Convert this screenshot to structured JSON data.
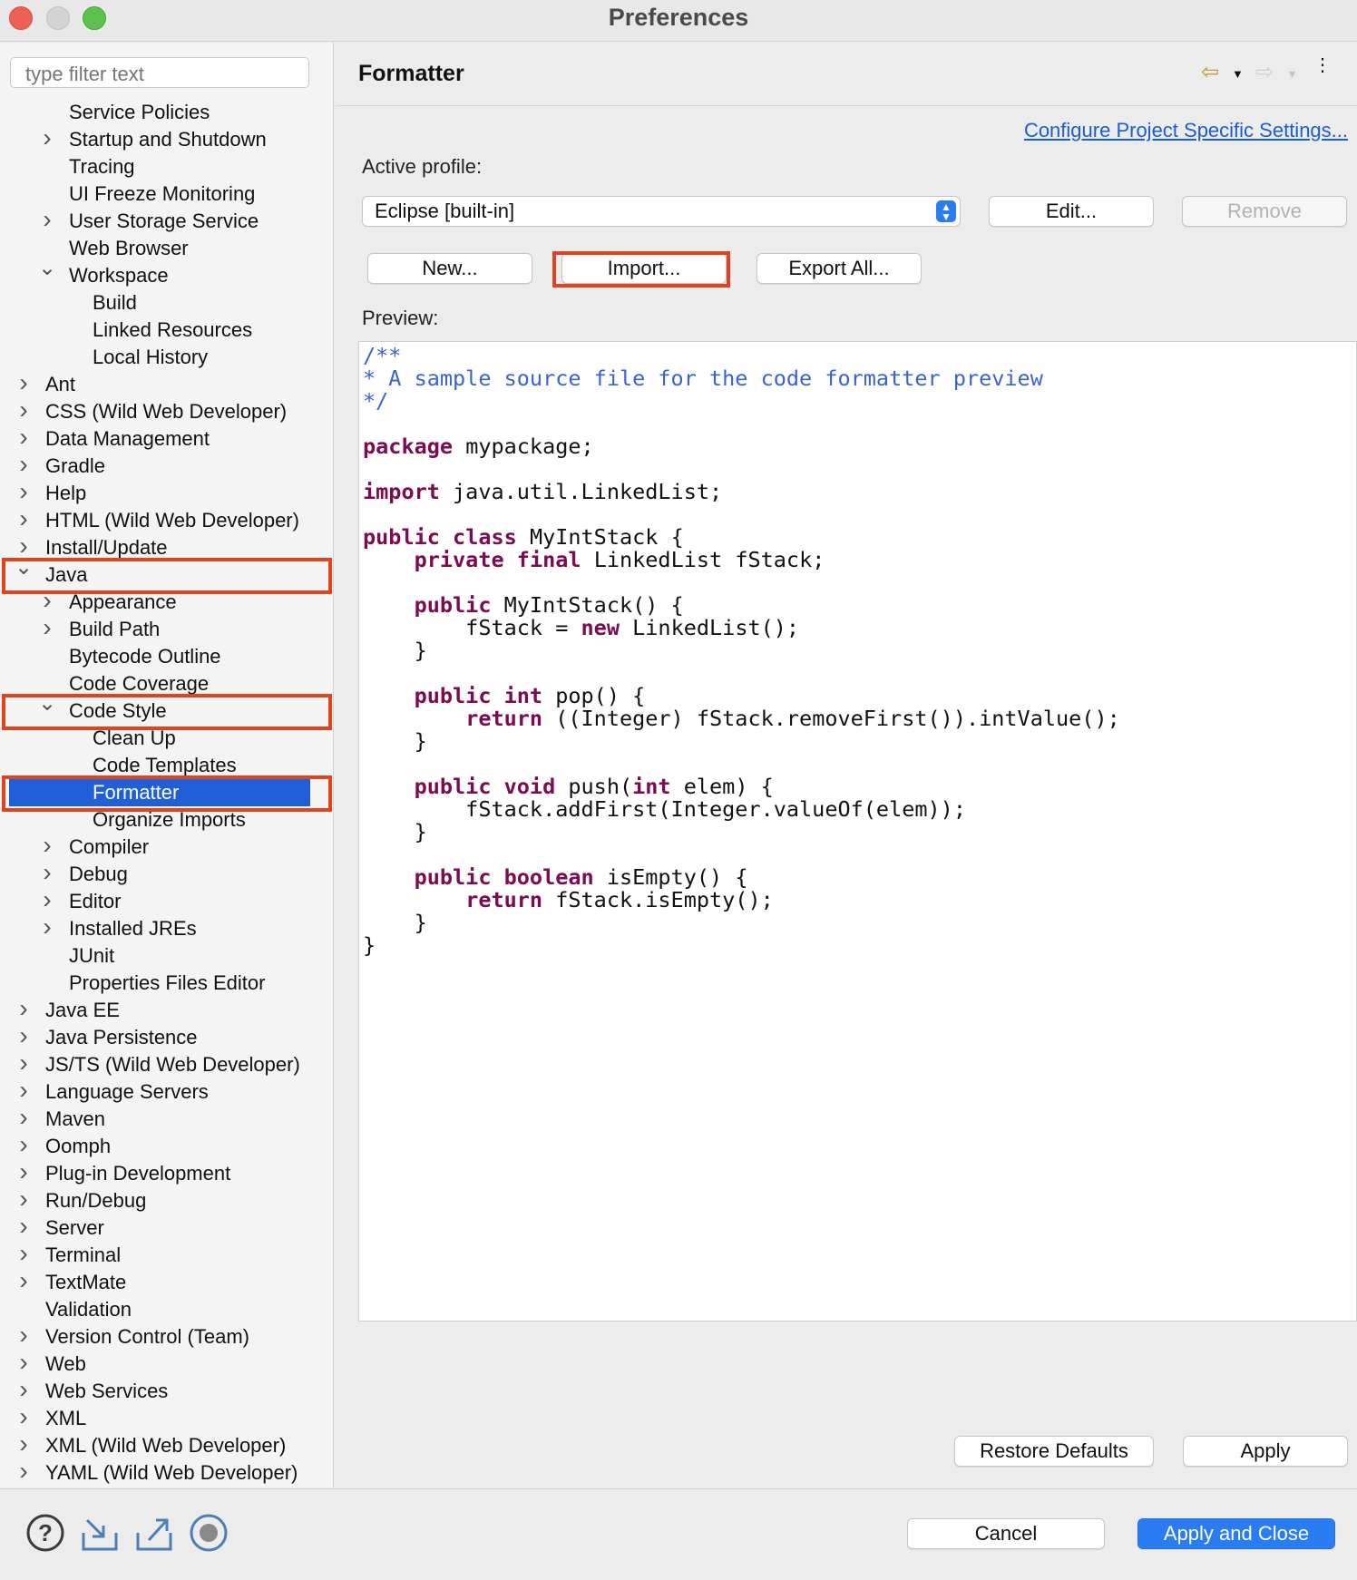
{
  "window": {
    "title": "Preferences"
  },
  "sidebar": {
    "filter_placeholder": "type filter text",
    "items": [
      {
        "label": "Service Policies",
        "level": 1,
        "expander": "none"
      },
      {
        "label": "Startup and Shutdown",
        "level": 1,
        "expander": "collapsed"
      },
      {
        "label": "Tracing",
        "level": 1,
        "expander": "none"
      },
      {
        "label": "UI Freeze Monitoring",
        "level": 1,
        "expander": "none"
      },
      {
        "label": "User Storage Service",
        "level": 1,
        "expander": "collapsed"
      },
      {
        "label": "Web Browser",
        "level": 1,
        "expander": "none"
      },
      {
        "label": "Workspace",
        "level": 1,
        "expander": "expanded"
      },
      {
        "label": "Build",
        "level": 2,
        "expander": "none"
      },
      {
        "label": "Linked Resources",
        "level": 2,
        "expander": "none"
      },
      {
        "label": "Local History",
        "level": 2,
        "expander": "none"
      },
      {
        "label": "Ant",
        "level": 0,
        "expander": "collapsed"
      },
      {
        "label": "CSS (Wild Web Developer)",
        "level": 0,
        "expander": "collapsed"
      },
      {
        "label": "Data Management",
        "level": 0,
        "expander": "collapsed"
      },
      {
        "label": "Gradle",
        "level": 0,
        "expander": "collapsed"
      },
      {
        "label": "Help",
        "level": 0,
        "expander": "collapsed"
      },
      {
        "label": "HTML (Wild Web Developer)",
        "level": 0,
        "expander": "collapsed"
      },
      {
        "label": "Install/Update",
        "level": 0,
        "expander": "collapsed"
      },
      {
        "label": "Java",
        "level": 0,
        "expander": "expanded",
        "highlighted": true
      },
      {
        "label": "Appearance",
        "level": 1,
        "expander": "collapsed"
      },
      {
        "label": "Build Path",
        "level": 1,
        "expander": "collapsed"
      },
      {
        "label": "Bytecode Outline",
        "level": 1,
        "expander": "none"
      },
      {
        "label": "Code Coverage",
        "level": 1,
        "expander": "none"
      },
      {
        "label": "Code Style",
        "level": 1,
        "expander": "expanded",
        "highlighted": true
      },
      {
        "label": "Clean Up",
        "level": 2,
        "expander": "none"
      },
      {
        "label": "Code Templates",
        "level": 2,
        "expander": "none"
      },
      {
        "label": "Formatter",
        "level": 2,
        "expander": "none",
        "selected": true,
        "highlighted": true
      },
      {
        "label": "Organize Imports",
        "level": 2,
        "expander": "none"
      },
      {
        "label": "Compiler",
        "level": 1,
        "expander": "collapsed"
      },
      {
        "label": "Debug",
        "level": 1,
        "expander": "collapsed"
      },
      {
        "label": "Editor",
        "level": 1,
        "expander": "collapsed"
      },
      {
        "label": "Installed JREs",
        "level": 1,
        "expander": "collapsed"
      },
      {
        "label": "JUnit",
        "level": 1,
        "expander": "none"
      },
      {
        "label": "Properties Files Editor",
        "level": 1,
        "expander": "none"
      },
      {
        "label": "Java EE",
        "level": 0,
        "expander": "collapsed"
      },
      {
        "label": "Java Persistence",
        "level": 0,
        "expander": "collapsed"
      },
      {
        "label": "JS/TS (Wild Web Developer)",
        "level": 0,
        "expander": "collapsed"
      },
      {
        "label": "Language Servers",
        "level": 0,
        "expander": "collapsed"
      },
      {
        "label": "Maven",
        "level": 0,
        "expander": "collapsed"
      },
      {
        "label": "Oomph",
        "level": 0,
        "expander": "collapsed"
      },
      {
        "label": "Plug-in Development",
        "level": 0,
        "expander": "collapsed"
      },
      {
        "label": "Run/Debug",
        "level": 0,
        "expander": "collapsed"
      },
      {
        "label": "Server",
        "level": 0,
        "expander": "collapsed"
      },
      {
        "label": "Terminal",
        "level": 0,
        "expander": "collapsed"
      },
      {
        "label": "TextMate",
        "level": 0,
        "expander": "collapsed"
      },
      {
        "label": "Validation",
        "level": 0,
        "expander": "none"
      },
      {
        "label": "Version Control (Team)",
        "level": 0,
        "expander": "collapsed"
      },
      {
        "label": "Web",
        "level": 0,
        "expander": "collapsed"
      },
      {
        "label": "Web Services",
        "level": 0,
        "expander": "collapsed"
      },
      {
        "label": "XML",
        "level": 0,
        "expander": "collapsed"
      },
      {
        "label": "XML (Wild Web Developer)",
        "level": 0,
        "expander": "collapsed"
      },
      {
        "label": "YAML (Wild Web Developer)",
        "level": 0,
        "expander": "collapsed"
      }
    ]
  },
  "main": {
    "title": "Formatter",
    "configure_link": "Configure Project Specific Settings...",
    "active_profile_label": "Active profile:",
    "profile_value": "Eclipse [built-in]",
    "buttons": {
      "edit": "Edit...",
      "remove": "Remove",
      "new": "New...",
      "import": "Import...",
      "export_all": "Export All...",
      "restore_defaults": "Restore Defaults",
      "apply": "Apply"
    },
    "preview_label": "Preview:",
    "code_lines": [
      [
        {
          "t": "/**",
          "c": "cm"
        }
      ],
      [
        {
          "t": "* A sample source file for the code formatter preview",
          "c": "cm"
        }
      ],
      [
        {
          "t": "*/",
          "c": "cm"
        }
      ],
      [],
      [
        {
          "t": "package",
          "c": "kw"
        },
        {
          "t": " mypackage;",
          "c": ""
        }
      ],
      [],
      [
        {
          "t": "import",
          "c": "kw"
        },
        {
          "t": " java.util.LinkedList;",
          "c": ""
        }
      ],
      [],
      [
        {
          "t": "public",
          "c": "kw"
        },
        {
          "t": " ",
          "c": ""
        },
        {
          "t": "class",
          "c": "kw"
        },
        {
          "t": " MyIntStack {",
          "c": ""
        }
      ],
      [
        {
          "t": "    ",
          "c": ""
        },
        {
          "t": "private",
          "c": "kw"
        },
        {
          "t": " ",
          "c": ""
        },
        {
          "t": "final",
          "c": "kw"
        },
        {
          "t": " LinkedList fStack;",
          "c": ""
        }
      ],
      [],
      [
        {
          "t": "    ",
          "c": ""
        },
        {
          "t": "public",
          "c": "kw"
        },
        {
          "t": " MyIntStack() {",
          "c": ""
        }
      ],
      [
        {
          "t": "        fStack = ",
          "c": ""
        },
        {
          "t": "new",
          "c": "kw"
        },
        {
          "t": " LinkedList();",
          "c": ""
        }
      ],
      [
        {
          "t": "    }",
          "c": ""
        }
      ],
      [],
      [
        {
          "t": "    ",
          "c": ""
        },
        {
          "t": "public",
          "c": "kw"
        },
        {
          "t": " ",
          "c": ""
        },
        {
          "t": "int",
          "c": "kw"
        },
        {
          "t": " pop() {",
          "c": ""
        }
      ],
      [
        {
          "t": "        ",
          "c": ""
        },
        {
          "t": "return",
          "c": "kw"
        },
        {
          "t": " ((Integer) fStack.removeFirst()).intValue();",
          "c": ""
        }
      ],
      [
        {
          "t": "    }",
          "c": ""
        }
      ],
      [],
      [
        {
          "t": "    ",
          "c": ""
        },
        {
          "t": "public",
          "c": "kw"
        },
        {
          "t": " ",
          "c": ""
        },
        {
          "t": "void",
          "c": "kw"
        },
        {
          "t": " push(",
          "c": ""
        },
        {
          "t": "int",
          "c": "kw"
        },
        {
          "t": " elem) {",
          "c": ""
        }
      ],
      [
        {
          "t": "        fStack.addFirst(Integer.valueOf(elem));",
          "c": ""
        }
      ],
      [
        {
          "t": "    }",
          "c": ""
        }
      ],
      [],
      [
        {
          "t": "    ",
          "c": ""
        },
        {
          "t": "public",
          "c": "kw"
        },
        {
          "t": " ",
          "c": ""
        },
        {
          "t": "boolean",
          "c": "kw"
        },
        {
          "t": " isEmpty() {",
          "c": ""
        }
      ],
      [
        {
          "t": "        ",
          "c": ""
        },
        {
          "t": "return",
          "c": "kw"
        },
        {
          "t": " fStack.isEmpty();",
          "c": ""
        }
      ],
      [
        {
          "t": "    }",
          "c": ""
        }
      ],
      [
        {
          "t": "}",
          "c": ""
        }
      ]
    ]
  },
  "footer": {
    "cancel": "Cancel",
    "apply_and_close": "Apply and Close",
    "icons": [
      "help-icon",
      "import-icon",
      "export-icon",
      "record-icon"
    ]
  },
  "colors": {
    "selection": "#1f5fd8",
    "highlight_box": "#e2431f",
    "keyword": "#7b0b52",
    "comment": "#3a63d0",
    "link": "#1a5ed6",
    "primary_button": "#2a7cf2"
  }
}
